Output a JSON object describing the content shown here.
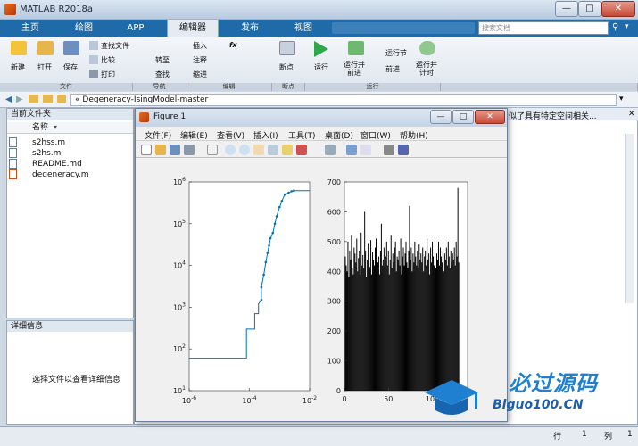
{
  "window": {
    "title": "MATLAB R2018a"
  },
  "tabs": [
    {
      "label": "主页",
      "active": false
    },
    {
      "label": "绘图",
      "active": false
    },
    {
      "label": "APP",
      "active": false
    },
    {
      "label": "编辑器",
      "active": true
    },
    {
      "label": "发布",
      "active": false
    },
    {
      "label": "视图",
      "active": false
    }
  ],
  "search": {
    "placeholder": "搜索文档"
  },
  "ribbon": {
    "new": "新建",
    "open": "打开",
    "save": "保存",
    "find_files": "查找文件",
    "compare": "比较",
    "print": "打印",
    "goto": "转至",
    "find": "查找",
    "insert": "插入",
    "comment": "注释",
    "indent": "缩进",
    "fx": "fx",
    "breakpoints": "断点",
    "run": "运行",
    "run_advance": "运行并\n前进",
    "run_section": "运行节",
    "advance": "前进",
    "run_time": "运行并\n计时",
    "groups": {
      "file": "文件",
      "navigate": "导航",
      "edit": "编辑",
      "breakpoints": "断点",
      "run": "运行"
    }
  },
  "address": {
    "path": "Degeneracy-IsingModel-master",
    "prefix": "«"
  },
  "current_folder": {
    "title": "当前文件夹",
    "column": "名称",
    "files": [
      {
        "name": "s2hss.m",
        "icon": "m-file-icon"
      },
      {
        "name": "s2hs.m",
        "icon": "m-file-icon"
      },
      {
        "name": "README.md",
        "icon": "text-file-icon"
      },
      {
        "name": "degeneracy.m",
        "icon": "matlab-function-icon"
      }
    ]
  },
  "details": {
    "title": "详细信息",
    "hint": "选择文件以查看详细信息"
  },
  "right_panel": {
    "snippet": "似了具有特定空间相关..."
  },
  "figure": {
    "title": "Figure 1",
    "menus": [
      "文件(F)",
      "编辑(E)",
      "查看(V)",
      "插入(I)",
      "工具(T)",
      "桌面(D)",
      "窗口(W)",
      "帮助(H)"
    ]
  },
  "status": {
    "row_label": "行",
    "row": "1",
    "col_label": "列",
    "col": "1"
  },
  "watermark": {
    "text": "必过源码",
    "url": "Biguo100.CN"
  },
  "chart_data": [
    {
      "type": "line",
      "xscale": "log",
      "yscale": "log",
      "xlim": [
        1e-06,
        0.01
      ],
      "ylim": [
        10,
        1000000
      ],
      "xticks": [
        "10-6",
        "10-4",
        "10-2"
      ],
      "yticks": [
        "101",
        "102",
        "103",
        "104",
        "105",
        "106"
      ],
      "color": "#0072bd",
      "x": [
        1e-06,
        8e-05,
        8e-05,
        0.00015,
        0.00015,
        0.0002,
        0.0002,
        0.00025,
        0.00025,
        0.0003,
        0.00035,
        0.0004,
        0.00045,
        0.0005,
        0.0006,
        0.0007,
        0.0008,
        0.001,
        0.0012,
        0.0015,
        0.002,
        0.0025,
        0.003,
        0.01
      ],
      "y": [
        60,
        60,
        300,
        300,
        700,
        700,
        1200,
        1500,
        3000,
        6000,
        12000,
        20000,
        30000,
        45000,
        60000,
        100000,
        150000,
        250000,
        350000,
        500000,
        550000,
        600000,
        620000,
        620000
      ]
    },
    {
      "type": "bar",
      "xlim": [
        0,
        140
      ],
      "ylim": [
        0,
        700
      ],
      "xticks": [
        0,
        50,
        100
      ],
      "yticks": [
        0,
        100,
        200,
        300,
        400,
        500,
        600,
        700
      ],
      "color": "#000000",
      "values": [
        450,
        420,
        400,
        500,
        380,
        470,
        440,
        520,
        410,
        390,
        480,
        460,
        430,
        510,
        400,
        445,
        470,
        390,
        530,
        420,
        455,
        410,
        600,
        470,
        380,
        440,
        495,
        430,
        415,
        505,
        390,
        465,
        440,
        420,
        480,
        510,
        400,
        430,
        450,
        390,
        470,
        560,
        420,
        440,
        480,
        410,
        450,
        500,
        420,
        470,
        390,
        440,
        520,
        410,
        460,
        430,
        480,
        500,
        400,
        450,
        440,
        470,
        420,
        510,
        390,
        450,
        480,
        420,
        460,
        500,
        430,
        410,
        470,
        620,
        440,
        480,
        400,
        460,
        430,
        500,
        450,
        420,
        470,
        410,
        490,
        440,
        460,
        430,
        480,
        400,
        450,
        470,
        420,
        510,
        440,
        460,
        390,
        480,
        430,
        500,
        450,
        420,
        470,
        410,
        460,
        440,
        500,
        420,
        480,
        450,
        430,
        470,
        400,
        460,
        440,
        480,
        420,
        500,
        450,
        410,
        470,
        430,
        460,
        440,
        480,
        420,
        500,
        450,
        680,
        430
      ]
    }
  ]
}
